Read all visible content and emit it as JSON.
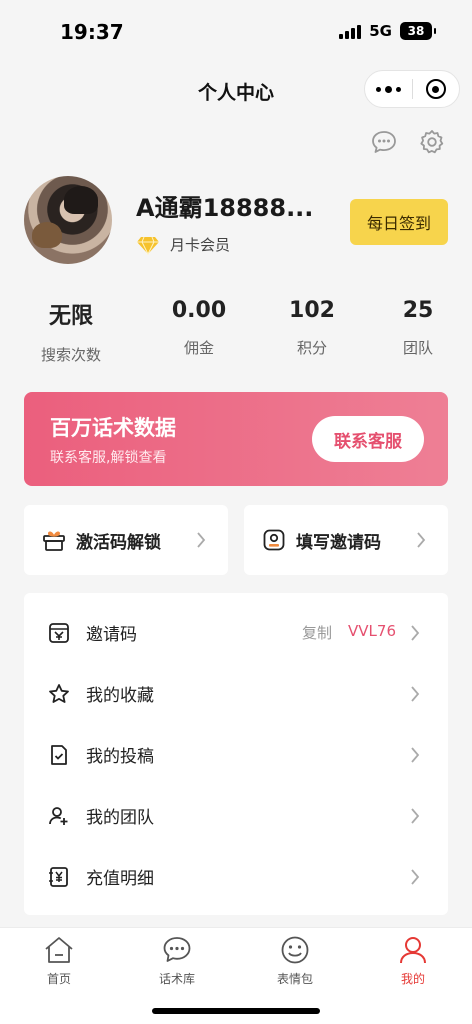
{
  "status_bar": {
    "time": "19:37",
    "network": "5G",
    "battery": "38"
  },
  "nav": {
    "title": "个人中心",
    "more_icon": "more-dots-icon",
    "close_icon": "target-circle-icon"
  },
  "top_icons": {
    "message_icon": "chat-bubble-icon",
    "settings_icon": "gear-icon"
  },
  "profile": {
    "username": "A通霸18888...",
    "membership": "月卡会员",
    "membership_icon": "diamond-icon",
    "checkin_label": "每日签到"
  },
  "stats": [
    {
      "value": "无限",
      "label": "搜索次数"
    },
    {
      "value": "0.00",
      "label": "佣金"
    },
    {
      "value": "102",
      "label": "积分"
    },
    {
      "value": "25",
      "label": "团队"
    }
  ],
  "banner": {
    "title": "百万话术数据",
    "subtitle": "联系客服,解锁查看",
    "button": "联系客服"
  },
  "quick_actions": [
    {
      "label": "激活码解锁",
      "icon": "gift-icon"
    },
    {
      "label": "填写邀请码",
      "icon": "user-card-icon"
    }
  ],
  "menu": {
    "items": [
      {
        "label": "邀请码",
        "icon": "invite-code-icon",
        "copy": "复制",
        "code": "VVL76"
      },
      {
        "label": "我的收藏",
        "icon": "star-icon"
      },
      {
        "label": "我的投稿",
        "icon": "document-check-icon"
      },
      {
        "label": "我的团队",
        "icon": "team-add-icon"
      },
      {
        "label": "充值明细",
        "icon": "yuan-bill-icon"
      }
    ]
  },
  "tabbar": {
    "items": [
      {
        "label": "首页",
        "icon": "home-icon"
      },
      {
        "label": "话术库",
        "icon": "chat-bubble-icon"
      },
      {
        "label": "表情包",
        "icon": "smile-icon"
      },
      {
        "label": "我的",
        "icon": "person-icon"
      }
    ],
    "active": "我的"
  },
  "colors": {
    "accent": "#e5506f",
    "checkin": "#f7d44c",
    "tab_active": "#e53935"
  }
}
